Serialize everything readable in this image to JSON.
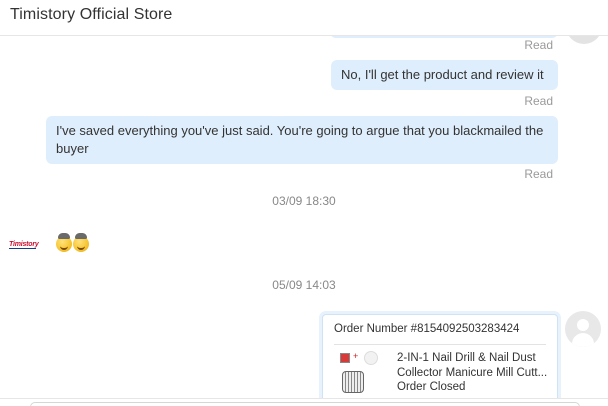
{
  "header": {
    "title": "Timistory Official Store"
  },
  "messages": [
    {
      "side": "right",
      "text": "No, I'll get the product and review it",
      "status": "Read"
    },
    {
      "side": "right",
      "text": "I've saved everything you've just said. You're going to argue that you blackmailed the buyer",
      "status": "Read"
    }
  ],
  "top_status": "Read",
  "timestamps": [
    "03/09 18:30",
    "05/09 14:03"
  ],
  "store": {
    "logo_text": "Timistory",
    "emoji_icons": [
      "cowboy-face-emoji",
      "cowboy-face-emoji"
    ]
  },
  "order_card": {
    "order_number": "Order Number #8154092503283424",
    "product_title_line1": "2-IN-1 Nail Drill & Nail Dust",
    "product_title_line2": "Collector Manicure Mill Cutt...",
    "status": "Order Closed"
  },
  "colors": {
    "bubble": "#dfeefc",
    "read": "#9a9a9a",
    "logo_red": "#c8102e"
  }
}
